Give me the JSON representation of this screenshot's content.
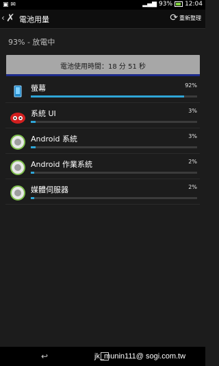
{
  "statusbar": {
    "time": "12:04",
    "battery_percent": "93%"
  },
  "actionbar": {
    "title": "電池用量",
    "refresh_label": "重新整理"
  },
  "summary": {
    "status": "93% - 放電中",
    "graph_label": "電池使用時間：18 分 51 秒"
  },
  "items": [
    {
      "name": "螢幕",
      "percent": "92%",
      "value": 0.92,
      "icon": "screen-icon"
    },
    {
      "name": "系統 UI",
      "percent": "3%",
      "value": 0.03,
      "icon": "system-ui-icon"
    },
    {
      "name": "Android 系統",
      "percent": "3%",
      "value": 0.03,
      "icon": "android-system-icon"
    },
    {
      "name": "Android 作業系統",
      "percent": "2%",
      "value": 0.02,
      "icon": "android-os-icon"
    },
    {
      "name": "媒體伺服器",
      "percent": "2%",
      "value": 0.02,
      "icon": "media-server-icon"
    }
  ],
  "watermark": "jk_munin111@ sogi.com.tw",
  "colors": {
    "progress": "#2fa5d6",
    "graph_bg": "#a7a7a7"
  }
}
